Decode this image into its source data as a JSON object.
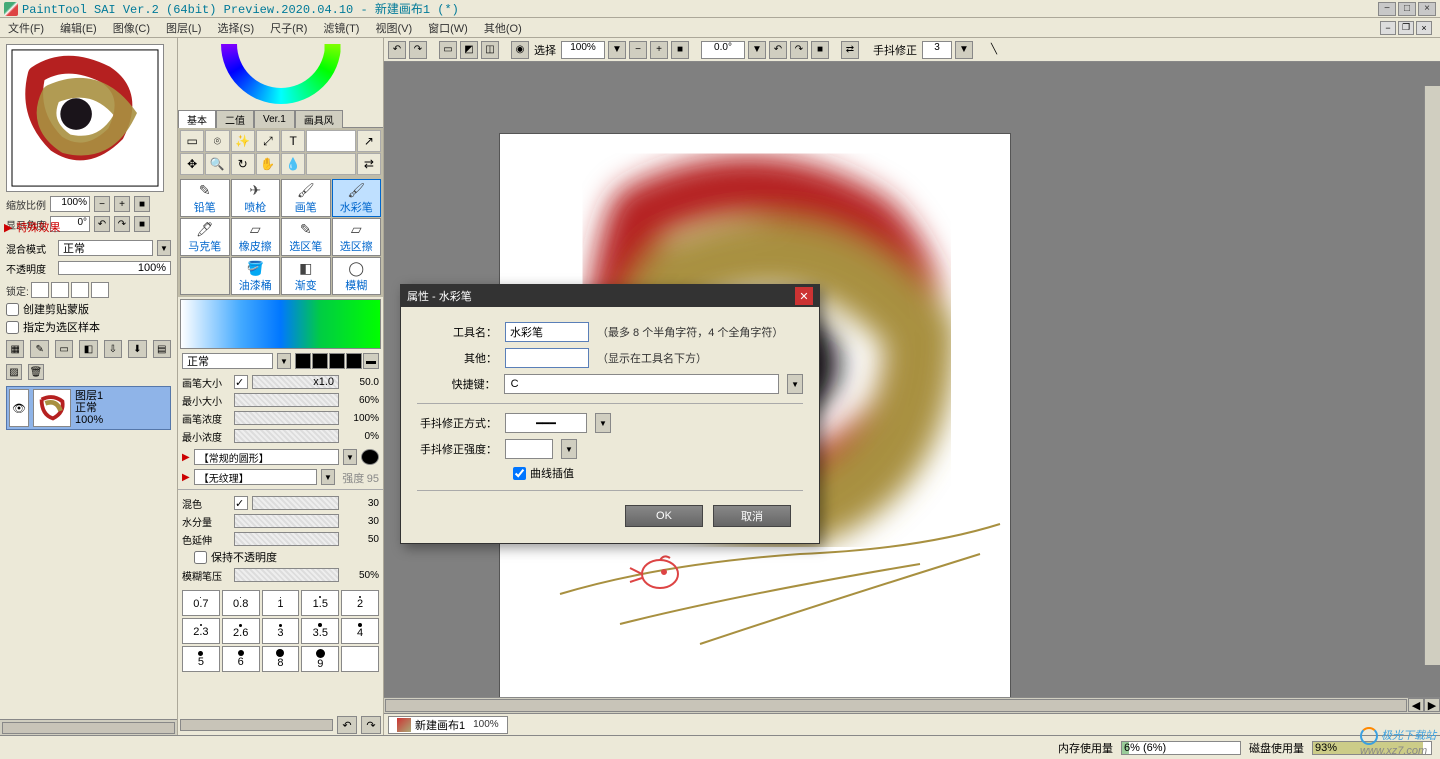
{
  "titlebar": {
    "title": "PaintTool SAI Ver.2 (64bit) Preview.2020.04.10 - 新建画布1 (*)"
  },
  "menu": {
    "items": [
      "文件(F)",
      "编辑(E)",
      "图像(C)",
      "图层(L)",
      "选择(S)",
      "尺子(R)",
      "滤镜(T)",
      "视图(V)",
      "窗口(W)",
      "其他(O)"
    ]
  },
  "navigator": {
    "zoom_label": "缩放比例",
    "zoom_value": "100%",
    "angle_label": "显示角度",
    "angle_value": "0°"
  },
  "effects_header": "特殊效果",
  "layerprops": {
    "blend_label": "混合模式",
    "blend_value": "正常",
    "opacity_label": "不透明度",
    "opacity_value": "100%",
    "lock_label": "锁定:",
    "clip_label": "创建剪贴蒙版",
    "selsrc_label": "指定为选区样本"
  },
  "layer": {
    "name": "图层1",
    "mode": "正常",
    "opacity": "100%"
  },
  "tooltabs": [
    "基本",
    "二值",
    "Ver.1",
    "画具风"
  ],
  "brushes": [
    {
      "name": "铅笔",
      "active": false
    },
    {
      "name": "喷枪",
      "active": false
    },
    {
      "name": "画笔",
      "active": false
    },
    {
      "name": "水彩笔",
      "active": true
    },
    {
      "name": "马克笔",
      "active": false
    },
    {
      "name": "橡皮擦",
      "active": false
    },
    {
      "name": "选区笔",
      "active": false
    },
    {
      "name": "选区擦",
      "active": false
    },
    {
      "name": "",
      "active": false
    },
    {
      "name": "油漆桶",
      "active": false
    },
    {
      "name": "渐变",
      "active": false
    },
    {
      "name": "模糊",
      "active": false
    }
  ],
  "brush_blend": "正常",
  "brushprops": {
    "size_label": "画笔大小",
    "size_mul": "x1.0",
    "size_val": "50.0",
    "minsize_label": "最小大小",
    "minsize_val": "60%",
    "density_label": "画笔浓度",
    "density_val": "100%",
    "mindens_label": "最小浓度",
    "mindens_val": "0%"
  },
  "presets": {
    "shape": "【常规的圆形】",
    "texture": "【无纹理】",
    "intensity": "强度",
    "intensity_val": "95"
  },
  "mix": {
    "blend_label": "混色",
    "blend_val": "30",
    "water_label": "水分量",
    "water_val": "30",
    "spread_label": "色延伸",
    "spread_val": "50",
    "keep_opacity": "保持不透明度",
    "blur_pressure_label": "模糊笔压",
    "blur_pressure_val": "50%"
  },
  "size_presets": [
    [
      "",
      "",
      "",
      "",
      ""
    ],
    [
      "0.7",
      "0.8",
      "1",
      "1.5",
      "2"
    ],
    [
      "",
      "",
      "",
      "",
      ""
    ],
    [
      "2.3",
      "2.6",
      "3",
      "3.5",
      "4"
    ],
    [
      "",
      "",
      "",
      "",
      ""
    ],
    [
      "5",
      "6",
      "8",
      "9",
      ""
    ]
  ],
  "toolbar2": {
    "select_label": "选择",
    "zoom": "100%",
    "angle": "0.0°",
    "stabilizer_label": "手抖修正",
    "stabilizer_val": "3"
  },
  "doctab": {
    "name": "新建画布1",
    "zoom": "100%"
  },
  "status": {
    "mem_label": "内存使用量",
    "mem_val": "6%",
    "mem_txt": "(6%)",
    "disk_label": "磁盘使用量",
    "disk_val": "93%"
  },
  "watermark": {
    "brand": "极光下载站",
    "url": "www.xz7.com"
  },
  "dialog": {
    "title": "属性 - 水彩笔",
    "name_label": "工具名：",
    "name_value": "水彩笔",
    "name_hint": "（最多 8 个半角字符，4 个全角字符）",
    "other_label": "其他：",
    "other_value": "",
    "other_hint": "（显示在工具名下方）",
    "shortcut_label": "快捷键：",
    "shortcut_value": "C",
    "stab_mode_label": "手抖修正方式：",
    "stab_strength_label": "手抖修正强度：",
    "curve_label": "曲线插值",
    "ok": "OK",
    "cancel": "取消"
  }
}
